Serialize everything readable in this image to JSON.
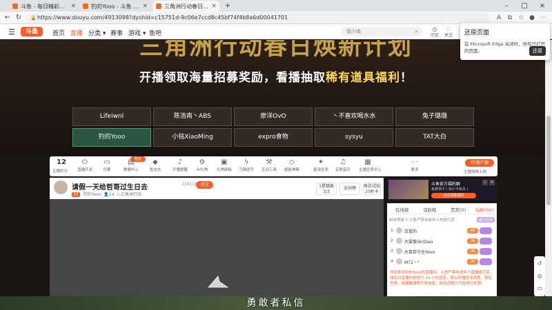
{
  "browser": {
    "tabs": [
      {
        "title": "斗鱼 - 每日精彩热推"
      },
      {
        "title": "钓的Yooo - 斗鱼 - 每日精彩热推"
      },
      {
        "title": "三角洲行动春日焕新计划_钓的Yooo"
      }
    ],
    "new_tab": "+",
    "url": "https://www.douyu.com/4913098?dyshid=c15751d-9c06e7ccd8c45bf74f4b8a6d00041701"
  },
  "restore_popup": {
    "title": "还原页面",
    "desc": "在 Microsoft Edge 关闭时，你有已打开的页面。",
    "button": "还原"
  },
  "site": {
    "logo": "斗鱼",
    "nav": [
      "首页",
      "直播",
      "分类",
      "赛事",
      "游戏",
      "鱼吧"
    ],
    "search_placeholder": "我小鳴",
    "header_icons": [
      {
        "icon": "history-icon",
        "label": "历史"
      },
      {
        "icon": "follow-icon",
        "label": "关注"
      }
    ]
  },
  "banner": {
    "headline": "三角洲行动春日焕新计划",
    "sub_a": "开播领取海量招募奖励，看播抽取",
    "sub_b": "稀有道具福利",
    "sub_c": "！",
    "streamers": [
      "Lifeiwnl",
      "陈浩南丶ABS",
      "廖洋OvO",
      "丶不喜欢喝水水",
      "兔子璐璐",
      "钓的Yooo",
      "小铭XiaoMing",
      "expro食物",
      "sysyu",
      "TAT大白"
    ],
    "selected_streamer": "钓的Yooo"
  },
  "toolbar": {
    "level": "12",
    "level_label": "主播积分",
    "badge_text": "任务",
    "badge_count": "1",
    "items": [
      {
        "icon": "live-switch-icon",
        "label": "直播开关"
      },
      {
        "icon": "ticket-icon",
        "label": "月票"
      },
      {
        "icon": "data-center-icon",
        "label": "数据中心"
      },
      {
        "icon": "drop-icon",
        "label": "鱼吉吉"
      },
      {
        "icon": "bell-icon",
        "label": "开播提醒"
      },
      {
        "icon": "ai-icon",
        "label": "AI礼物"
      },
      {
        "icon": "gift-icon",
        "label": "礼物面板"
      },
      {
        "icon": "lightning-icon",
        "label": "刀锋助手"
      },
      {
        "icon": "tools-icon",
        "label": "互动工具"
      },
      {
        "icon": "crystal-icon",
        "label": "超能神殿"
      },
      {
        "icon": "star-icon",
        "label": "星海任务"
      },
      {
        "icon": "music-icon",
        "label": "定制音乐"
      },
      {
        "icon": "calendar-icon",
        "label": "主播任务中心"
      },
      {
        "icon": "more-icon",
        "label": "更多"
      }
    ],
    "pc_button": "PC客户端",
    "pc_label": "主播放映上线"
  },
  "live": {
    "title": "请假一天给哲哥过生日去",
    "heat": "234138",
    "follow": "关注",
    "level_tag": "32",
    "streamer": "钓的Yooo",
    "followers": "24",
    "category": "三角洲行动",
    "box1_a": "1星跳高",
    "box1_b": "3/3",
    "box2": "全站榜",
    "box3_a": "每日试玩",
    "box3_b": "20秒卡"
  },
  "ad": {
    "title": "斗鱼官方福利群",
    "desc": "免费领卡 | 派小卡免兑 |",
    "button": "点击领取福利"
  },
  "rank": {
    "tabs": [
      "在线榜",
      "活跃榜",
      "贵宾(0)",
      "钻粉(56)"
    ],
    "active_tab": "钻粉(56)",
    "sub": "粉丝等级  5  斗鱼严禁未成年人充值打赏",
    "sub_right": "成为钻粉",
    "rows": [
      {
        "rank": "1",
        "name": "白鼠的",
        "level": "40"
      },
      {
        "rank": "2",
        "name": "大婴美SkrDiao",
        "level": "38"
      },
      {
        "rank": "3",
        "name": "大鼠若守住Yooo",
        "level": "38"
      },
      {
        "rank": "4",
        "name": "M72丶°",
        "level": "38"
      }
    ],
    "notice": "欢迎来到钓的Yooo的直播间。斗鱼严禁未成年人直播或打赏。绿法对直播内容进行 24 小时巡查，禁止传播违法违规、低俗色情、吸烟酗酒等不良信息，如有违规行为将进行处理。"
  },
  "caption": "勇敢者私信"
}
